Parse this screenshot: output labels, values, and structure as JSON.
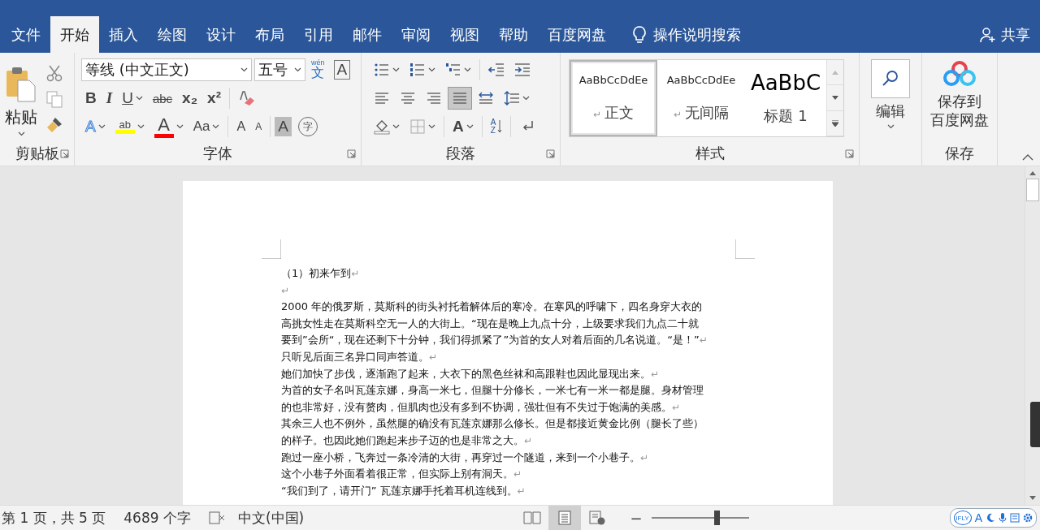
{
  "tabs": [
    {
      "label": "文件",
      "selected": false
    },
    {
      "label": "开始",
      "selected": true
    },
    {
      "label": "插入",
      "selected": false
    },
    {
      "label": "绘图",
      "selected": false
    },
    {
      "label": "设计",
      "selected": false
    },
    {
      "label": "布局",
      "selected": false
    },
    {
      "label": "引用",
      "selected": false
    },
    {
      "label": "邮件",
      "selected": false
    },
    {
      "label": "审阅",
      "selected": false
    },
    {
      "label": "视图",
      "selected": false
    },
    {
      "label": "帮助",
      "selected": false
    },
    {
      "label": "百度网盘",
      "selected": false
    }
  ],
  "tell_me": {
    "label": "操作说明搜索"
  },
  "share": {
    "label": "共享"
  },
  "clipboard": {
    "label": "剪贴板",
    "paste": "粘贴"
  },
  "font": {
    "label": "字体",
    "name_field": "等线 (中文正文)",
    "size_field": "五号",
    "top_tools": [
      {
        "kind": "phonetic",
        "glyph": "文",
        "ruby": "wén"
      },
      {
        "kind": "border-char",
        "glyph": "A"
      }
    ],
    "format_tools": [
      {
        "kind": "bold",
        "glyph": "B"
      },
      {
        "kind": "italic",
        "glyph": "I"
      },
      {
        "kind": "underline",
        "glyph": "U",
        "dropdown": true
      },
      {
        "kind": "strike",
        "glyph": "abc"
      },
      {
        "kind": "sub",
        "glyph": "x₂"
      },
      {
        "kind": "sup",
        "glyph": "x²"
      },
      {
        "kind": "sep"
      },
      {
        "kind": "eraser"
      }
    ],
    "color_tools": [
      {
        "kind": "effects",
        "glyph": "A",
        "dropdown": true
      },
      {
        "kind": "highlight",
        "glyph": "ab",
        "color": "#ffff00",
        "dropdown": true
      },
      {
        "kind": "font-color",
        "glyph": "A",
        "color": "#ff0000",
        "dropdown": true
      },
      {
        "kind": "case",
        "glyph": "Aa",
        "dropdown": true
      },
      {
        "kind": "sep"
      },
      {
        "kind": "grow",
        "glyph": "A"
      },
      {
        "kind": "shrink",
        "glyph": "A"
      },
      {
        "kind": "sep"
      },
      {
        "kind": "shading",
        "glyph": "A"
      },
      {
        "kind": "enclose",
        "glyph": "字"
      }
    ]
  },
  "paragraph": {
    "label": "段落",
    "list_tools": [
      {
        "kind": "bullets",
        "dropdown": true
      },
      {
        "kind": "numbering",
        "dropdown": true
      },
      {
        "kind": "multilevel",
        "dropdown": true
      },
      {
        "kind": "sep"
      },
      {
        "kind": "outdent"
      },
      {
        "kind": "indent"
      }
    ],
    "align_tools": [
      {
        "kind": "align-left",
        "selected": false
      },
      {
        "kind": "align-center",
        "selected": false
      },
      {
        "kind": "align-right",
        "selected": false
      },
      {
        "kind": "justify",
        "selected": true
      },
      {
        "kind": "distribute",
        "selected": false
      },
      {
        "kind": "line-spacing",
        "dropdown": true
      }
    ],
    "misc_tools": [
      {
        "kind": "fill",
        "dropdown": true
      },
      {
        "kind": "borders",
        "dropdown": true
      },
      {
        "kind": "sep"
      },
      {
        "kind": "asian-layout",
        "glyph": "A",
        "dropdown": true
      },
      {
        "kind": "sep"
      },
      {
        "kind": "sort",
        "glyph": "AZ"
      },
      {
        "kind": "sep"
      },
      {
        "kind": "marks"
      }
    ]
  },
  "styles": {
    "label": "样式",
    "items": [
      {
        "kind": "normal",
        "preview": "AaBbCcDdEe",
        "name": "正文",
        "mark": "↵",
        "selected": true
      },
      {
        "kind": "normal",
        "preview": "AaBbCcDdEe",
        "name": "无间隔",
        "mark": "↵",
        "selected": false
      },
      {
        "kind": "heading",
        "preview": "AaBbC",
        "name": "标题 1",
        "selected": false
      }
    ]
  },
  "editing": {
    "label": "编辑"
  },
  "save": {
    "label": "保存",
    "button": [
      "保存到",
      "百度网盘"
    ]
  },
  "document": {
    "lines": [
      {
        "text": "（1）初来乍到",
        "mark": "↵"
      },
      {
        "mark": "↵"
      },
      {
        "text": "2000 年的俄罗斯，莫斯科的街头衬托着解体后的寒冷。在寒风的呼啸下，四名身穿大衣的"
      },
      {
        "text": "高挑女性走在莫斯科空无一人的大街上。“现在是晚上九点十分，上级要求我们九点二十就"
      },
      {
        "text": "要到”会所“，现在还剩下十分钟，我们得抓紧了”为首的女人对着后面的几名说道。“是！”",
        "mark": "↵"
      },
      {
        "text": "只听见后面三名异口同声答道。",
        "mark": "↵"
      },
      {
        "text": "她们加快了步伐，逐渐跑了起来，大衣下的黑色丝袜和高跟鞋也因此显现出来。",
        "mark": "↵"
      },
      {
        "text": "为首的女子名叫瓦莲京娜，身高一米七，但腿十分修长，一米七有一米一都是腿。身材管理"
      },
      {
        "text": "的也非常好，没有赘肉，但肌肉也没有多到不协调，强壮但有不失过于饱满的美感。",
        "mark": "↵"
      },
      {
        "text": "其余三人也不例外，虽然腿的确没有瓦莲京娜那么修长。但是都接近黄金比例（腿长了些）"
      },
      {
        "text": "的样子。也因此她们跑起来步子迈的也是非常之大。",
        "mark": "↵"
      },
      {
        "text": "跑过一座小桥，飞奔过一条冷清的大街，再穿过一个隧道，来到一个小巷子。",
        "mark": "↵"
      },
      {
        "text": "这个小巷子外面看着很正常，但实际上别有洞天。",
        "mark": "↵"
      },
      {
        "text": "“我们到了，请开门” 瓦莲京娜手托着耳机连线到。",
        "mark": "↵"
      }
    ]
  },
  "status_bar": {
    "page": "第 1 页，共 5 页",
    "words": "4689 个字",
    "language": "中文(中国)",
    "views": [
      {
        "kind": "read",
        "selected": false
      },
      {
        "kind": "print",
        "selected": true
      },
      {
        "kind": "web",
        "selected": false
      }
    ],
    "zoom_out": "−",
    "zoom": {
      "level": 0.64
    },
    "ime": {
      "logo": "iFLY",
      "mode": "A"
    }
  }
}
